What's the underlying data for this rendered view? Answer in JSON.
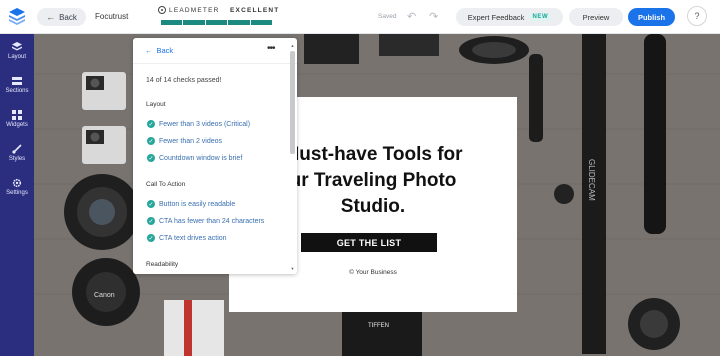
{
  "topbar": {
    "back_label": "Back",
    "site_name": "Focutrust",
    "meter_brand": "LEADMETER",
    "meter_status": "EXCELLENT",
    "meter_segments": 5,
    "saved_label": "Saved",
    "expert_label": "Expert Feedback",
    "new_badge": "NEW",
    "preview_label": "Preview",
    "publish_label": "Publish",
    "help_label": "?"
  },
  "sidebar": {
    "items": [
      {
        "label": "Layout",
        "icon": "layers-icon"
      },
      {
        "label": "Sections",
        "icon": "sections-icon"
      },
      {
        "label": "Widgets",
        "icon": "widgets-icon"
      },
      {
        "label": "Styles",
        "icon": "brush-icon"
      },
      {
        "label": "Settings",
        "icon": "gear-icon"
      }
    ]
  },
  "panel": {
    "back_label": "Back",
    "more_label": "•••",
    "summary": "14 of 14 checks passed!",
    "sections": [
      {
        "title": "Layout",
        "checks": [
          "Fewer than 3 videos (Critical)",
          "Fewer than 2 videos",
          "Countdown window is brief"
        ]
      },
      {
        "title": "Call To Action",
        "checks": [
          "Button is easily readable",
          "CTA has fewer than 24 characters",
          "CTA text drives action"
        ]
      },
      {
        "title": "Readability",
        "checks": []
      }
    ]
  },
  "landing": {
    "headline_1": "Must-have Tools for",
    "headline_2": "ur Traveling Photo",
    "headline_3": "Studio.",
    "cta_label": "GET THE LIST",
    "footer": "© Your Business"
  },
  "colors": {
    "accent": "#1a73e8",
    "sidebar": "#2b2d7e",
    "meter": "#1c8a80",
    "check": "#27a79b"
  }
}
